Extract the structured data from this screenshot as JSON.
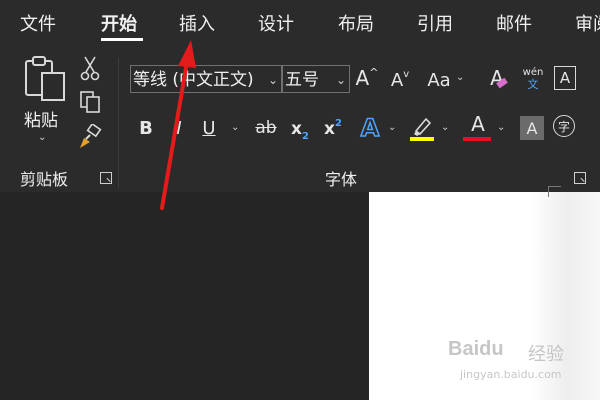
{
  "tabs": [
    {
      "label": "文件",
      "active": false
    },
    {
      "label": "开始",
      "active": true
    },
    {
      "label": "插入",
      "active": false
    },
    {
      "label": "设计",
      "active": false
    },
    {
      "label": "布局",
      "active": false
    },
    {
      "label": "引用",
      "active": false
    },
    {
      "label": "邮件",
      "active": false
    },
    {
      "label": "审阅",
      "active": false
    }
  ],
  "clipboard": {
    "group_label": "剪贴板",
    "paste_label": "粘贴",
    "icons": [
      "paste-icon",
      "cut-icon",
      "copy-icon",
      "format-painter-icon"
    ]
  },
  "font": {
    "group_label": "字体",
    "font_name": "等线 (中文正文)",
    "font_size": "五号",
    "row1": {
      "grow": "A",
      "shrink": "A",
      "change_case": "Aa",
      "clear_format": "A",
      "phonetic_top": "wén",
      "phonetic_bottom": "文",
      "char_border": "A"
    },
    "row2": {
      "bold": "B",
      "italic": "I",
      "underline": "U",
      "strikethrough": "ab",
      "subscript_base": "x",
      "subscript": "2",
      "superscript_base": "x",
      "superscript": "2",
      "text_effects": "A",
      "font_color": "A",
      "char_shading": "A",
      "enclose": "字"
    },
    "highlight_color": "#ffff00",
    "font_color_value": "#e81123"
  },
  "watermark": {
    "logo": "Baidu",
    "text": "经验",
    "url": "jingyan.baidu.com"
  },
  "annotation_color": "#e41b1b"
}
